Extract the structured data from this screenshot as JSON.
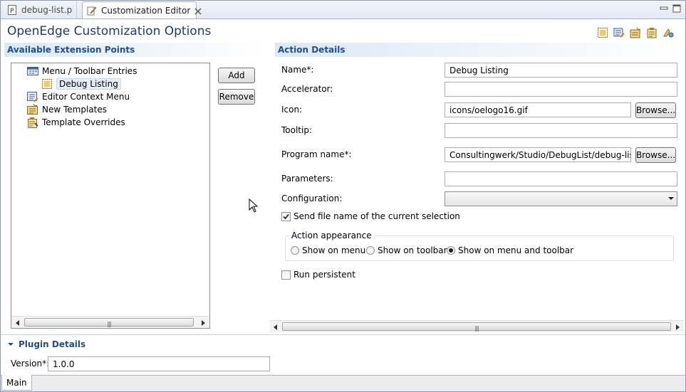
{
  "tabs": [
    {
      "label": "debug-list.p",
      "icon": "p-file-icon",
      "active": false
    },
    {
      "label": "Customization Editor",
      "icon": "customization-editor-icon",
      "active": true
    }
  ],
  "window_controls": [
    "minimize-icon",
    "maximize-icon"
  ],
  "form": {
    "title": "OpenEdge Customization Options",
    "toolbar_icons": [
      "toolbar-menu-entry-icon",
      "toolbar-context-menu-icon",
      "toolbar-new-template-icon",
      "toolbar-template-override-icon",
      "toolbar-export-icon"
    ]
  },
  "extension_points": {
    "heading": "Available Extension Points",
    "items": [
      {
        "label": "Menu / Toolbar Entries",
        "icon": "menu-toolbar-icon",
        "level": 0
      },
      {
        "label": "Debug Listing",
        "icon": "debug-listing-icon",
        "level": 1,
        "selected": true
      },
      {
        "label": "Editor Context Menu",
        "icon": "editor-context-menu-icon",
        "level": 0
      },
      {
        "label": "New Templates",
        "icon": "new-templates-icon",
        "level": 0
      },
      {
        "label": "Template Overrides",
        "icon": "template-overrides-icon",
        "level": 0
      }
    ],
    "add_label": "Add",
    "remove_label": "Remove"
  },
  "action_details": {
    "heading": "Action Details",
    "name_label": "Name*:",
    "name_value": "Debug Listing",
    "accelerator_label": "Accelerator:",
    "accelerator_value": "",
    "icon_label": "Icon:",
    "icon_value": "icons/oelogo16.gif",
    "browse_label": "Browse...",
    "tooltip_label": "Tooltip:",
    "tooltip_value": "",
    "program_label": "Program name*:",
    "program_value": "Consultingwerk/Studio/DebugList/debug-list.p",
    "parameters_label": "Parameters:",
    "parameters_value": "",
    "configuration_label": "Configuration:",
    "configuration_value": "",
    "send_file_label": "Send file name of the current selection",
    "send_file_checked": true,
    "appearance_legend": "Action appearance",
    "appearance_options": [
      {
        "label": "Show on menu",
        "selected": false
      },
      {
        "label": "Show on toolbar",
        "selected": false
      },
      {
        "label": "Show on menu and toolbar",
        "selected": true
      }
    ],
    "run_persistent_label": "Run persistent",
    "run_persistent_checked": false
  },
  "plugin_details": {
    "heading": "Plugin Details",
    "version_label": "Version*:",
    "version_value": "1.0.0"
  },
  "bottom_tab": "Main",
  "colors": {
    "section_heading": "#1f4f8f",
    "title": "#1f3a6e",
    "border": "#8a9bb3"
  }
}
